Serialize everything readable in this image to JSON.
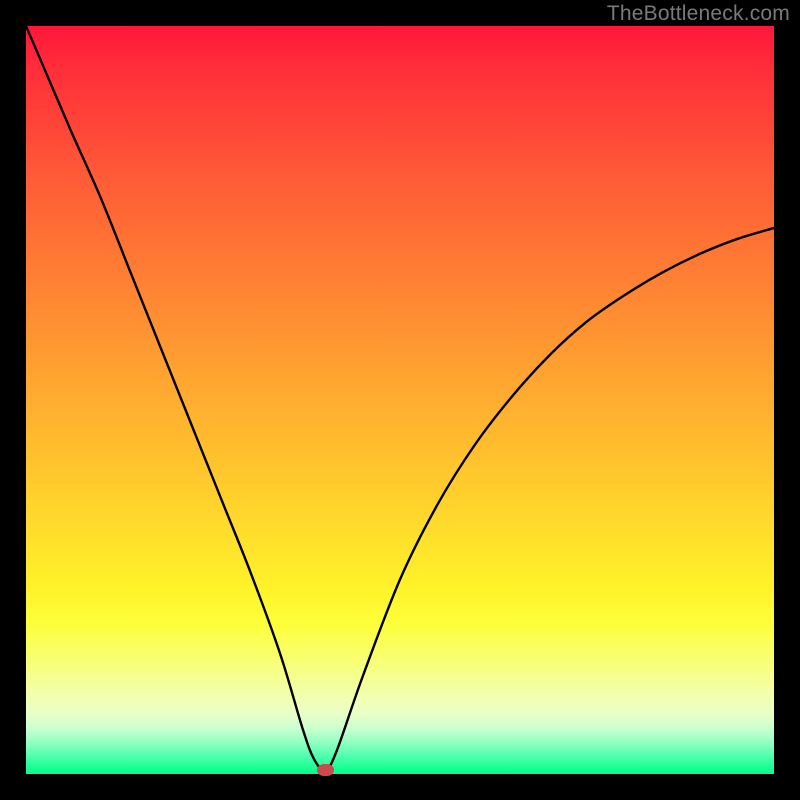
{
  "watermark": "TheBottleneck.com",
  "chart_data": {
    "type": "line",
    "title": "",
    "xlabel": "",
    "ylabel": "",
    "xlim": [
      0,
      100
    ],
    "ylim": [
      0,
      100
    ],
    "grid": false,
    "legend": false,
    "x": [
      0,
      3,
      6,
      10,
      14,
      18,
      22,
      26,
      30,
      34,
      37,
      38.5,
      40,
      41.5,
      45,
      50,
      55,
      60,
      65,
      70,
      75,
      80,
      85,
      90,
      95,
      100
    ],
    "values": [
      100,
      93,
      86,
      77,
      67,
      57,
      47,
      37,
      27,
      16,
      6,
      2,
      0.5,
      3,
      13,
      26,
      36,
      44,
      50.5,
      56,
      60.5,
      64,
      67,
      69.5,
      71.5,
      73
    ],
    "marker": {
      "x": 40,
      "y": 0.5
    },
    "colors": {
      "background_gradient_top": "#ff163a",
      "background_gradient_bottom": "#00ff88",
      "curve": "#000000",
      "marker": "#c84c4c",
      "frame": "#000000"
    }
  }
}
